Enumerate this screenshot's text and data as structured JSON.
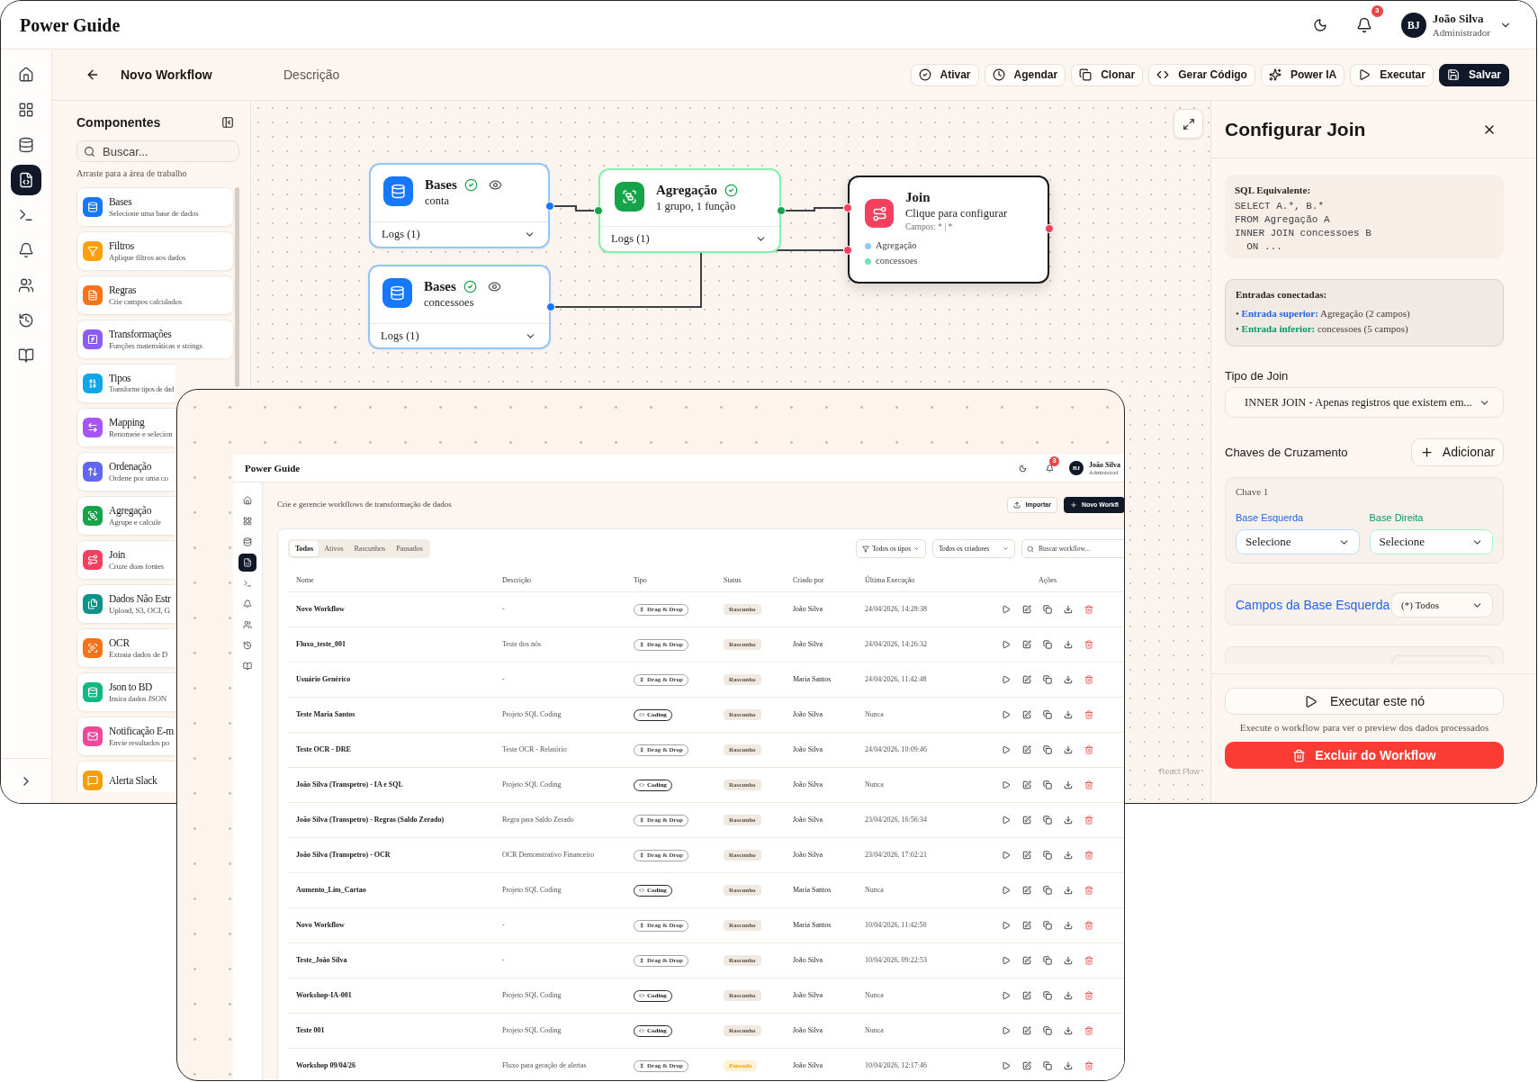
{
  "header": {
    "brand": "Power Guide",
    "notifications": "3",
    "user": {
      "initials": "BJ",
      "name": "João Silva",
      "role": "Administrador"
    }
  },
  "rail": {
    "items": [
      {
        "kind": "home",
        "selected": false
      },
      {
        "kind": "dashboard",
        "selected": false
      },
      {
        "kind": "database",
        "selected": false
      },
      {
        "kind": "workflows",
        "selected": true
      },
      {
        "kind": "terminal",
        "selected": false
      },
      {
        "kind": "notifications",
        "selected": false
      },
      {
        "kind": "users",
        "selected": false
      },
      {
        "kind": "history",
        "selected": false
      },
      {
        "kind": "docs",
        "selected": false
      }
    ]
  },
  "workflow_bar": {
    "title": "Novo Workflow",
    "description_field": {
      "placeholder": "Descrição"
    },
    "actions": [
      {
        "kind": "activate",
        "label": "Ativar",
        "primary": false
      },
      {
        "kind": "schedule",
        "label": "Agendar",
        "primary": false
      },
      {
        "kind": "clone",
        "label": "Clonar",
        "primary": false
      },
      {
        "kind": "code",
        "label": "Gerar Código",
        "primary": false
      },
      {
        "kind": "ai",
        "label": "Power IA",
        "primary": false
      },
      {
        "kind": "run",
        "label": "Executar",
        "primary": false
      },
      {
        "kind": "save",
        "label": "Salvar",
        "primary": true
      }
    ]
  },
  "components": {
    "title": "Componentes",
    "search": {
      "placeholder": "Buscar..."
    },
    "hint": "Arraste para a área de trabalho",
    "items": [
      {
        "kind": "bases",
        "title": "Bases",
        "description": "Selecione uma base de dados",
        "color": "#1677ff"
      },
      {
        "kind": "filters",
        "title": "Filtros",
        "description": "Aplique filtros aos dados",
        "color": "#ff9f0a"
      },
      {
        "kind": "rules",
        "title": "Regras",
        "description": "Crie campos calculados",
        "color": "#f97316"
      },
      {
        "kind": "transforms",
        "title": "Transformações",
        "description": "Funções matemáticas e strings",
        "color": "#8b5cf6"
      },
      {
        "kind": "types",
        "title": "Tipos",
        "description": "Transforme tipos de dad",
        "color": "#0ea5e9"
      },
      {
        "kind": "mapping",
        "title": "Mapping",
        "description": "Renomeie e selecion",
        "color": "#a855f7"
      },
      {
        "kind": "sort",
        "title": "Ordenação",
        "description": "Ordene por uma co",
        "color": "#6366f1"
      },
      {
        "kind": "aggregation",
        "title": "Agregação",
        "description": "Agrupe e calcule",
        "color": "#16a34a"
      },
      {
        "kind": "join",
        "title": "Join",
        "description": "Cruze duas fontes",
        "color": "#f43f5e"
      },
      {
        "kind": "unstructured",
        "title": "Dados Não Estr",
        "description": "Upload, S3, OCI, G",
        "color": "#0d9488"
      },
      {
        "kind": "ocr",
        "title": "OCR",
        "description": "Extraia dados de D",
        "color": "#f97316"
      },
      {
        "kind": "json",
        "title": "Json to BD",
        "description": "Insira dados JSON",
        "color": "#10b981"
      },
      {
        "kind": "email",
        "title": "Notificação E-m",
        "description": "Envie resultados po",
        "color": "#ec4899"
      },
      {
        "kind": "slack",
        "title": "Alerta Slack",
        "color": "#f59e0b"
      }
    ]
  },
  "canvas": {
    "nodes": [
      {
        "kind": "base",
        "title": "Bases",
        "subtitle": "conta",
        "verified": true,
        "logs": "Logs (1)",
        "selected": false
      },
      {
        "kind": "base",
        "title": "Bases",
        "subtitle": "concessoes",
        "verified": true,
        "logs": "Logs (1)",
        "selected": false
      },
      {
        "kind": "aggregation",
        "title": "Agregação",
        "subtitle": "1 grupo, 1 função",
        "verified": true,
        "logs": "Logs (1)",
        "selected": false
      },
      {
        "kind": "join",
        "title": "Join",
        "subtitle": "Clique para configurar",
        "fields": "Campos: * | *",
        "inputs": [
          {
            "label": "Agregação",
            "color": "#93c5fd"
          },
          {
            "label": "concessoes",
            "color": "#6ee7b7"
          }
        ],
        "verified": false,
        "selected": true
      }
    ],
    "attribution": "React Flow"
  },
  "config_panel": {
    "title": "Configurar Join",
    "sql": {
      "label": "SQL Equivalente:",
      "lines": [
        "SELECT A.*, B.*",
        "FROM Agregação A",
        "INNER JOIN concessoes B",
        "  ON ..."
      ]
    },
    "inputs": {
      "title": "Entradas conectadas:",
      "items": [
        {
          "bullet": "•",
          "label": "Entrada superior:",
          "text": "Agregação (2 campos)",
          "color": "#2563eb"
        },
        {
          "bullet": "•",
          "label": "Entrada inferior:",
          "text": "concessoes (5 campos)",
          "color": "#059669"
        }
      ]
    },
    "join_type": {
      "label": "Tipo de Join",
      "value": "INNER JOIN - Apenas registros que existem em..."
    },
    "keys": {
      "title": "Chaves de Cruzamento",
      "add_label": "Adicionar",
      "items": [
        {
          "title": "Chave 1",
          "left": {
            "label": "Base Esquerda",
            "value": "Selecione"
          },
          "right": {
            "label": "Base Direita",
            "value": "Selecione"
          }
        }
      ]
    },
    "left_fields": {
      "label": "Campos da Base Esquerda",
      "value": "(*) Todos"
    },
    "run_label": "Executar este nó",
    "run_hint": "Execute o workflow para ver o preview dos dados processados",
    "delete_label": "Excluir do Workflow"
  },
  "workflows_screenshot": {
    "header": {
      "brand": "Power Guide",
      "notifications": "3",
      "user": {
        "initials": "BJ",
        "name": "João Silva",
        "role": "Administrad"
      }
    },
    "rail": {
      "items": [
        {
          "kind": "home",
          "selected": false
        },
        {
          "kind": "dashboard",
          "selected": false
        },
        {
          "kind": "database",
          "selected": false
        },
        {
          "kind": "workflows",
          "selected": true
        },
        {
          "kind": "terminal",
          "selected": false
        },
        {
          "kind": "notifications",
          "selected": false
        },
        {
          "kind": "users",
          "selected": false
        },
        {
          "kind": "history",
          "selected": false
        },
        {
          "kind": "docs",
          "selected": false
        }
      ]
    },
    "subtitle": "Crie e gerencie workflows de transformação de dados",
    "actions": [
      {
        "kind": "import",
        "label": "Importar",
        "primary": false
      },
      {
        "kind": "new",
        "label": "Novo Workfl",
        "primary": true
      }
    ],
    "tabs": [
      {
        "label": "Todos",
        "selected": true
      },
      {
        "label": "Ativos",
        "selected": false
      },
      {
        "label": "Rascunhos",
        "selected": false
      },
      {
        "label": "Pausados",
        "selected": false
      }
    ],
    "filters": [
      {
        "kind": "type",
        "label": "Todos os tipos"
      },
      {
        "kind": "creator",
        "label": "Todos os criadores"
      }
    ],
    "search": {
      "placeholder": "Buscar workflow..."
    },
    "table": {
      "columns": [
        "Nome",
        "Descrição",
        "Tipo",
        "Status",
        "Criado por",
        "Última Execução",
        "Ações"
      ],
      "rows": [
        {
          "name": "Novo Workflow",
          "description": "-",
          "type": {
            "kind": "drag",
            "label": "Drag & Drop"
          },
          "status": {
            "kind": "draft",
            "label": "Rascunho"
          },
          "created_by": "João Silva",
          "last_run": "24/04/2026, 14:28:38"
        },
        {
          "name": "Fluxo_teste_001",
          "description": "Teste dos nós",
          "type": {
            "kind": "drag",
            "label": "Drag & Drop"
          },
          "status": {
            "kind": "draft",
            "label": "Rascunho"
          },
          "created_by": "João Silva",
          "last_run": "24/04/2026, 14:26:32"
        },
        {
          "name": "Usuário Genérico",
          "description": "-",
          "type": {
            "kind": "drag",
            "label": "Drag & Drop"
          },
          "status": {
            "kind": "draft",
            "label": "Rascunho"
          },
          "created_by": "Maria Santos",
          "last_run": "24/04/2026, 11:42:48"
        },
        {
          "name": "Teste Maria Santos",
          "description": "Projeto SQL Coding",
          "type": {
            "kind": "code",
            "label": "Coding"
          },
          "status": {
            "kind": "draft",
            "label": "Rascunho"
          },
          "created_by": "João Silva",
          "last_run": "Nunca"
        },
        {
          "name": "Teste OCR - DRE",
          "description": "Teste OCR - Relatório",
          "type": {
            "kind": "drag",
            "label": "Drag & Drop"
          },
          "status": {
            "kind": "draft",
            "label": "Rascunho"
          },
          "created_by": "João Silva",
          "last_run": "24/04/2026, 10:09:46"
        },
        {
          "name": "João Silva (Transpetro) - IA e SQL",
          "description": "Projeto SQL Coding",
          "type": {
            "kind": "code",
            "label": "Coding"
          },
          "status": {
            "kind": "draft",
            "label": "Rascunho"
          },
          "created_by": "João Silva",
          "last_run": "Nunca"
        },
        {
          "name": "João Silva (Transpetro) - Regras (Saldo Zerado)",
          "description": "Regra para Saldo Zerado",
          "type": {
            "kind": "drag",
            "label": "Drag & Drop"
          },
          "status": {
            "kind": "draft",
            "label": "Rascunho"
          },
          "created_by": "João Silva",
          "last_run": "23/04/2026, 16:56:34"
        },
        {
          "name": "João Silva (Transpetro) - OCR",
          "description": "OCR Demonstrativo Financeiro",
          "type": {
            "kind": "drag",
            "label": "Drag & Drop"
          },
          "status": {
            "kind": "draft",
            "label": "Rascunho"
          },
          "created_by": "João Silva",
          "last_run": "23/04/2026, 17:02:21"
        },
        {
          "name": "Aumento_Lim_Cartao",
          "description": "Projeto SQL Coding",
          "type": {
            "kind": "code",
            "label": "Coding"
          },
          "status": {
            "kind": "draft",
            "label": "Rascunho"
          },
          "created_by": "Maria Santos",
          "last_run": "Nunca"
        },
        {
          "name": "Novo Workflow",
          "description": "-",
          "type": {
            "kind": "drag",
            "label": "Drag & Drop"
          },
          "status": {
            "kind": "draft",
            "label": "Rascunho"
          },
          "created_by": "Maria Santos",
          "last_run": "10/04/2026, 11:42:50"
        },
        {
          "name": "Teste_João Silva",
          "description": "-",
          "type": {
            "kind": "drag",
            "label": "Drag & Drop"
          },
          "status": {
            "kind": "draft",
            "label": "Rascunho"
          },
          "created_by": "João Silva",
          "last_run": "10/04/2026, 09:22:53"
        },
        {
          "name": "Workshop-IA-001",
          "description": "Projeto SQL Coding",
          "type": {
            "kind": "code",
            "label": "Coding"
          },
          "status": {
            "kind": "draft",
            "label": "Rascunho"
          },
          "created_by": "João Silva",
          "last_run": "Nunca"
        },
        {
          "name": "Teste 001",
          "description": "Projeto SQL Coding",
          "type": {
            "kind": "code",
            "label": "Coding"
          },
          "status": {
            "kind": "draft",
            "label": "Rascunho"
          },
          "created_by": "João Silva",
          "last_run": "Nunca"
        },
        {
          "name": "Workshop 09/04/26",
          "description": "Fluxo para geração de alertas",
          "type": {
            "kind": "drag",
            "label": "Drag & Drop"
          },
          "status": {
            "kind": "paused",
            "label": "Pausado"
          },
          "created_by": "João Silva",
          "last_run": "10/04/2026, 12:17:46"
        }
      ]
    }
  }
}
